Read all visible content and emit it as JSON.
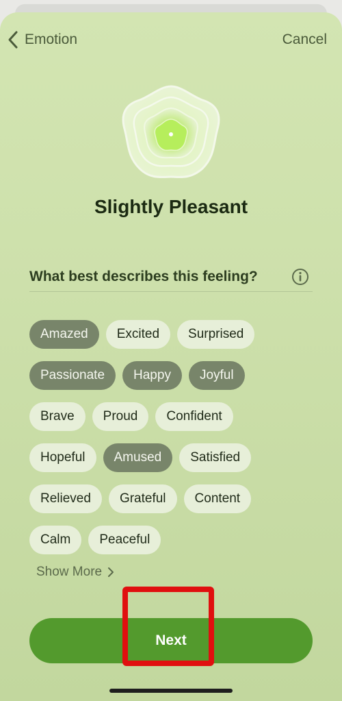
{
  "header": {
    "back_label": "Emotion",
    "cancel_label": "Cancel"
  },
  "title": "Slightly Pleasant",
  "question": "What best describes this feeling?",
  "chip_rows": [
    [
      {
        "label": "Amazed",
        "selected": true
      },
      {
        "label": "Excited",
        "selected": false
      },
      {
        "label": "Surprised",
        "selected": false
      }
    ],
    [
      {
        "label": "Passionate",
        "selected": true
      },
      {
        "label": "Happy",
        "selected": true
      },
      {
        "label": "Joyful",
        "selected": true
      }
    ],
    [
      {
        "label": "Brave",
        "selected": false
      },
      {
        "label": "Proud",
        "selected": false
      },
      {
        "label": "Confident",
        "selected": false
      }
    ],
    [
      {
        "label": "Hopeful",
        "selected": false
      },
      {
        "label": "Amused",
        "selected": true
      },
      {
        "label": "Satisfied",
        "selected": false
      }
    ],
    [
      {
        "label": "Relieved",
        "selected": false
      },
      {
        "label": "Grateful",
        "selected": false
      },
      {
        "label": "Content",
        "selected": false
      }
    ],
    [
      {
        "label": "Calm",
        "selected": false
      },
      {
        "label": "Peaceful",
        "selected": false
      }
    ]
  ],
  "show_more_label": "Show More",
  "next_label": "Next",
  "colors": {
    "accent": "#539a2d",
    "chip_selected": "#78856a",
    "chip_unselected": "#e7efd9",
    "highlight": "#e00f0f"
  },
  "icons": {
    "back": "chevron-left-icon",
    "info": "info-circle-icon",
    "show_more": "chevron-right-icon"
  }
}
